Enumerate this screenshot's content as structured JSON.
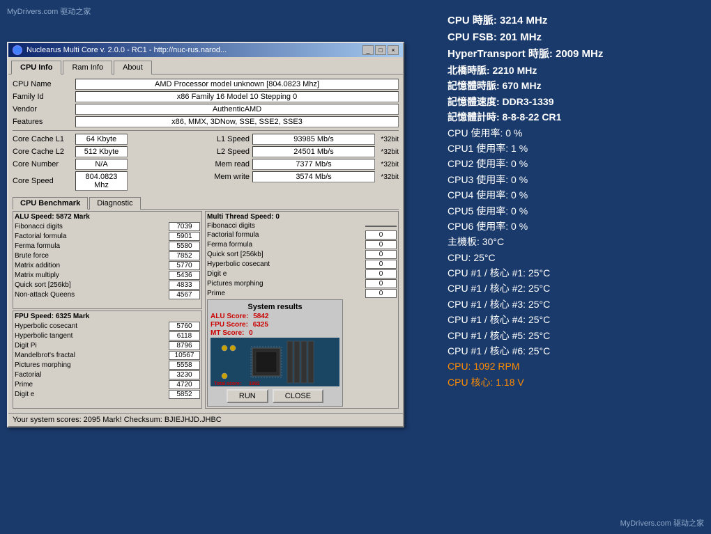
{
  "watermark_top": "MyDrivers.com 驱动之家",
  "watermark_bottom": "MyDrivers.com 驱动之家",
  "window": {
    "title": "Nuclearus Multi Core  v. 2.0.0  -  RC1  -  http://nuc-rus.narod...",
    "tabs": [
      {
        "label": "CPU Info",
        "active": true
      },
      {
        "label": "Ram Info",
        "active": false
      },
      {
        "label": "About",
        "active": false
      }
    ],
    "cpu_info": {
      "cpu_name_label": "CPU Name",
      "cpu_name_value": "AMD Processor model unknown [804.0823 Mhz]",
      "family_id_label": "Family Id",
      "family_id_value": "x86 Family 16 Model 10 Stepping 0",
      "vendor_label": "Vendor",
      "vendor_value": "AuthenticAMD",
      "features_label": "Features",
      "features_value": "x86, MMX, 3DNow, SSE, SSE2, SSE3",
      "core_cache_l1_label": "Core Cache L1",
      "core_cache_l1_value": "64 Kbyte",
      "core_cache_l2_label": "Core Cache L2",
      "core_cache_l2_value": "512 Kbyte",
      "core_number_label": "Core Number",
      "core_number_value": "N/A",
      "core_speed_label": "Core Speed",
      "core_speed_value": "804.0823 Mhz",
      "l1_speed_label": "L1 Speed",
      "l1_speed_value": "93985 Mb/s",
      "l1_badge": "*32bit",
      "l2_speed_label": "L2 Speed",
      "l2_speed_value": "24501 Mb/s",
      "l2_badge": "*32bit",
      "mem_read_label": "Mem read",
      "mem_read_value": "7377 Mb/s",
      "mem_read_badge": "*32bit",
      "mem_write_label": "Mem write",
      "mem_write_value": "3574 Mb/s",
      "mem_write_badge": "*32bit"
    },
    "bench_tabs": [
      {
        "label": "CPU Benchmark",
        "active": true
      },
      {
        "label": "Diagnostic",
        "active": false
      }
    ],
    "alu": {
      "header": "ALU Speed: 5872 Mark",
      "rows": [
        {
          "label": "Fibonacci digits",
          "value": "7039"
        },
        {
          "label": "Factorial formula",
          "value": "5901"
        },
        {
          "label": "Ferma formula",
          "value": "5580"
        },
        {
          "label": "Brute force",
          "value": "7852"
        },
        {
          "label": "Matrix addition",
          "value": "5770"
        },
        {
          "label": "Matrix multiply",
          "value": "5436"
        },
        {
          "label": "Quick sort [256kb]",
          "value": "4833"
        },
        {
          "label": "Non-attack Queens",
          "value": "4567"
        }
      ]
    },
    "mt": {
      "header": "Multi Thread Speed: 0",
      "rows": [
        {
          "label": "Fibonacci digits",
          "value": ""
        },
        {
          "label": "Factorial formula",
          "value": "0"
        },
        {
          "label": "Ferma formula",
          "value": "0"
        },
        {
          "label": "Quick sort [256kb]",
          "value": "0"
        },
        {
          "label": "Hyperbolic cosecant",
          "value": "0"
        },
        {
          "label": "Digit e",
          "value": "0"
        },
        {
          "label": "Pictures morphing",
          "value": "0"
        },
        {
          "label": "Prime",
          "value": "0"
        }
      ]
    },
    "fpu": {
      "header": "FPU Speed: 6325 Mark",
      "rows": [
        {
          "label": "Hyperbolic cosecant",
          "value": "5760"
        },
        {
          "label": "Hyperbolic tangent",
          "value": "6118"
        },
        {
          "label": "Digit Pi",
          "value": "8796"
        },
        {
          "label": "Mandelbrot's fractal",
          "value": "10567"
        },
        {
          "label": "Pictures morphing",
          "value": "5558"
        },
        {
          "label": "Factorial",
          "value": "3230"
        },
        {
          "label": "Prime",
          "value": "4720"
        },
        {
          "label": "Digit e",
          "value": "5852"
        }
      ]
    },
    "results": {
      "title": "System results",
      "alu_score_label": "ALU Score:",
      "alu_score_value": "5842",
      "fpu_score_label": "FPU Score:",
      "fpu_score_value": "6325",
      "mt_score_label": "MT Score:",
      "mt_score_value": "0",
      "total_label": "Total score:",
      "total_value": "1992",
      "run_btn": "RUN",
      "close_btn": "CLOSE"
    },
    "status_bar": "Your system scores: 2095 Mark!    Checksum: BJIEJHJD.JHBC"
  },
  "right_panel": {
    "stats": [
      {
        "text": "CPU 時脈: 3214 MHz",
        "color": "white"
      },
      {
        "text": "CPU FSB: 201 MHz",
        "color": "white"
      },
      {
        "text": "HyperTransport 時脈: 2009 MHz",
        "color": "white"
      },
      {
        "text": "北橋時脈: 2210 MHz",
        "color": "white"
      },
      {
        "text": "記憶體時脈: 670 MHz",
        "color": "white"
      },
      {
        "text": "記憶體速度: DDR3-1339",
        "color": "white"
      },
      {
        "text": "記憶體計時: 8-8-8-22 CR1",
        "color": "white"
      },
      {
        "text": "CPU 使用率: 0 %",
        "color": "white"
      },
      {
        "text": "CPU1 使用率: 1 %",
        "color": "white"
      },
      {
        "text": "CPU2 使用率: 0 %",
        "color": "white"
      },
      {
        "text": "CPU3 使用率: 0 %",
        "color": "white"
      },
      {
        "text": "CPU4 使用率: 0 %",
        "color": "white"
      },
      {
        "text": "CPU5 使用率: 0 %",
        "color": "white"
      },
      {
        "text": "CPU6 使用率: 0 %",
        "color": "white"
      },
      {
        "text": "主機板: 30°C",
        "color": "white"
      },
      {
        "text": "CPU: 25°C",
        "color": "white"
      },
      {
        "text": "CPU #1 / 核心 #1: 25°C",
        "color": "white"
      },
      {
        "text": "CPU #1 / 核心 #2: 25°C",
        "color": "white"
      },
      {
        "text": "CPU #1 / 核心 #3: 25°C",
        "color": "white"
      },
      {
        "text": "CPU #1 / 核心 #4: 25°C",
        "color": "white"
      },
      {
        "text": "CPU #1 / 核心 #5: 25°C",
        "color": "white"
      },
      {
        "text": "CPU #1 / 核心 #6: 25°C",
        "color": "white"
      },
      {
        "text": "CPU: 1092 RPM",
        "color": "orange"
      },
      {
        "text": "CPU 核心: 1.18 V",
        "color": "orange"
      }
    ]
  }
}
